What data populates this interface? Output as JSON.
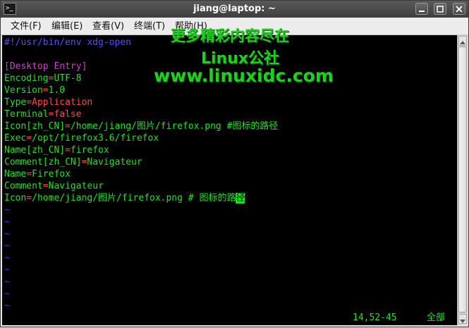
{
  "window": {
    "title": "jiang@laptop: ~",
    "icon_glyph": ">_"
  },
  "menu": {
    "items": [
      "文件(F)",
      "编辑(E)",
      "查看(V)",
      "终端(T)",
      "帮助(H)"
    ]
  },
  "file": {
    "shebang": "#!/usr/bin/env xdg-open",
    "section": "[Desktop Entry]",
    "entries": [
      {
        "key": "Encoding",
        "value": "UTF-8",
        "style": "green"
      },
      {
        "key": "Version",
        "value": "1.0",
        "style": "green"
      },
      {
        "key": "Type",
        "value": "Application",
        "style": "red"
      },
      {
        "key": "Terminal",
        "value": "false",
        "style": "red"
      },
      {
        "key": "Icon[zh_CN]",
        "value": "/home/jiang/图片/firefox.png #图标的路径",
        "style": "green"
      },
      {
        "key": "Exec",
        "value": "/opt/firefox3.6/firefox",
        "style": "green"
      },
      {
        "key": "Name[zh_CN]",
        "value": "firefox",
        "style": "green"
      },
      {
        "key": "Comment[zh_CN]",
        "value": "Navigateur",
        "style": "green"
      },
      {
        "key": "Name",
        "value": "Firefox",
        "style": "green"
      },
      {
        "key": "Comment",
        "value": "Navigateur",
        "style": "green"
      },
      {
        "key": "Icon",
        "value": "/home/jiang/图片/firefox.png # 图标的路",
        "style": "green"
      }
    ],
    "cursor_char": "径",
    "empty_line_marker": "~"
  },
  "status": {
    "position": "14,52-45",
    "scroll": "全部"
  },
  "watermark": {
    "line1": "更多精彩内容尽在",
    "line2": "Linux公社",
    "line3": "www.linuxidc.com"
  }
}
